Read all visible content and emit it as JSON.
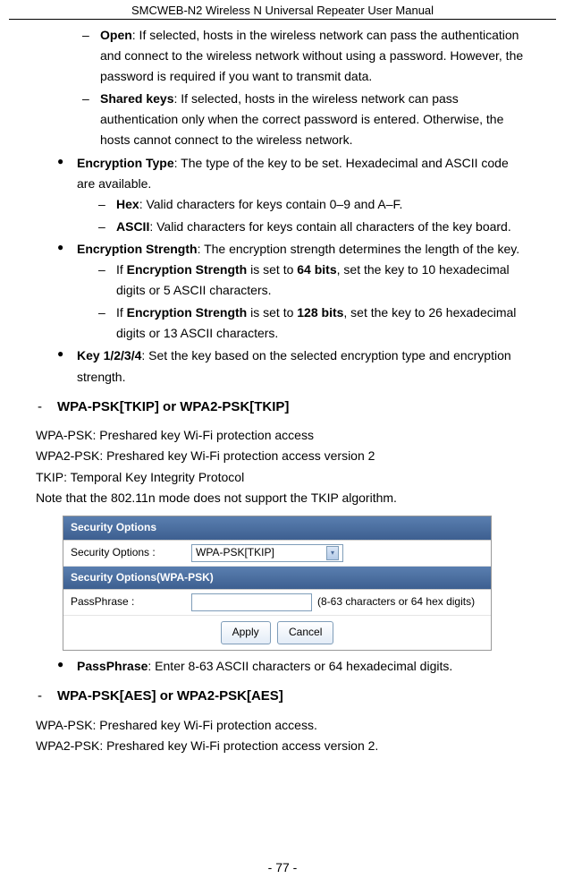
{
  "header": {
    "title": "SMCWEB-N2 Wireless N Universal Repeater User Manual"
  },
  "items1": {
    "open": {
      "label": "Open",
      "text": ": If selected, hosts in the wireless network can pass the authentication and connect to the wireless network without using a password. However, the password is required if you want to transmit data."
    },
    "shared": {
      "label": "Shared keys",
      "text": ": If selected, hosts in the wireless network can pass authentication only when the correct password is entered. Otherwise, the hosts cannot connect to the wireless network."
    }
  },
  "bullets1": {
    "encType": {
      "label": "Encryption Type",
      "text": ": The type of the key to be set. Hexadecimal and ASCII code are available."
    },
    "hex": {
      "label": "Hex",
      "text": ": Valid characters for keys contain 0–9 and A–F."
    },
    "ascii": {
      "label": "ASCII",
      "text": ": Valid characters for keys contain all characters of the key board."
    },
    "encStrength": {
      "label": "Encryption Strength",
      "text": ": The encryption strength determines the length of the key."
    },
    "s64a": "If ",
    "s64b": "Encryption Strength",
    "s64c": " is set to ",
    "s64d": "64 bits",
    "s64e": ", set the key to 10 hexadecimal digits or 5 ASCII characters.",
    "s128a": "If ",
    "s128b": "Encryption Strength",
    "s128c": " is set to ",
    "s128d": "128 bits",
    "s128e": ", set the key to 26 hexadecimal digits or 13 ASCII characters.",
    "key1234": {
      "label": "Key 1/2/3/4",
      "text": ": Set the key based on the selected encryption type and encryption strength."
    }
  },
  "sectionA": {
    "heading": "WPA-PSK[TKIP] or WPA2-PSK[TKIP]",
    "p1": "WPA-PSK: Preshared key Wi-Fi protection access",
    "p2": "WPA2-PSK: Preshared key Wi-Fi protection access version 2",
    "p3": "TKIP: Temporal Key Integrity Protocol",
    "p4": "Note that the 802.11n mode does not support the TKIP algorithm."
  },
  "screenshot": {
    "h1": "Security Options",
    "secLabel": "Security Options :",
    "secValue": "WPA-PSK[TKIP]",
    "h2": "Security Options(WPA-PSK)",
    "passLabel": "PassPhrase :",
    "hint": "(8-63 characters or 64 hex digits)",
    "apply": "Apply",
    "cancel": "Cancel"
  },
  "passphrase": {
    "label": "PassPhrase",
    "text": ": Enter 8-63 ASCII characters or 64 hexadecimal digits."
  },
  "sectionB": {
    "heading": "WPA-PSK[AES] or WPA2-PSK[AES]",
    "p1": "WPA-PSK: Preshared key Wi-Fi protection access.",
    "p2": "WPA2-PSK: Preshared key Wi-Fi protection access version 2."
  },
  "footer": {
    "page": "- 77 -"
  }
}
